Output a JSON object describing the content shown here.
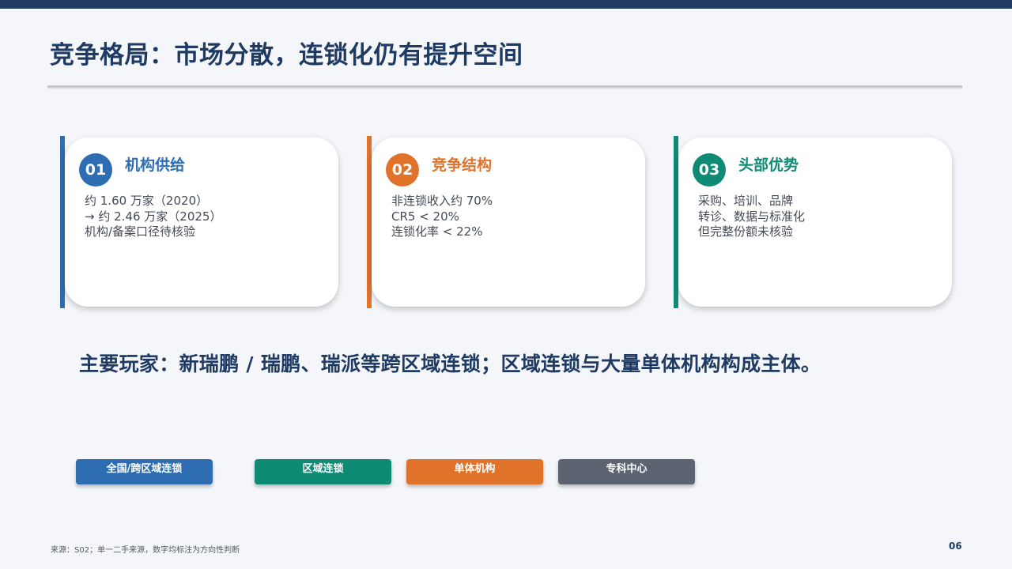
{
  "slide": {
    "title": "竞争格局：市场分散，连锁化仍有提升空间",
    "colors": {
      "navy": "#1f3b63",
      "blue": "#2e6db1",
      "orange": "#e0722a",
      "teal": "#0f8a74",
      "gray": "#5b6470"
    }
  },
  "cards": [
    {
      "number": "01",
      "title": "机构供给",
      "lines": [
        "约 1.60 万家（2020）",
        "→ 约 2.46 万家（2025）",
        "机构/备案口径待核验"
      ]
    },
    {
      "number": "02",
      "title": "竞争结构",
      "lines": [
        "非连锁收入约 70%",
        "CR5 < 20%",
        "连锁化率 < 22%"
      ]
    },
    {
      "number": "03",
      "title": "头部优势",
      "lines": [
        "采购、培训、品牌",
        "转诊、数据与标准化",
        "但完整份额未核验"
      ]
    }
  ],
  "players": {
    "text": "主要玩家：新瑞鹏 / 瑞鹏、瑞派等跨区域连锁；区域连锁与大量单体机构构成主体。"
  },
  "categories": [
    {
      "label": "全国/跨区域连锁",
      "color": "#2e6db1"
    },
    {
      "label": "区域连锁",
      "color": "#0f8a74"
    },
    {
      "label": "单体机构",
      "color": "#e0722a"
    },
    {
      "label": "专科中心",
      "color": "#5b6470"
    }
  ],
  "footer": {
    "source": "来源：S02；单一二手来源，数字均标注为方向性判断",
    "page": "06"
  }
}
